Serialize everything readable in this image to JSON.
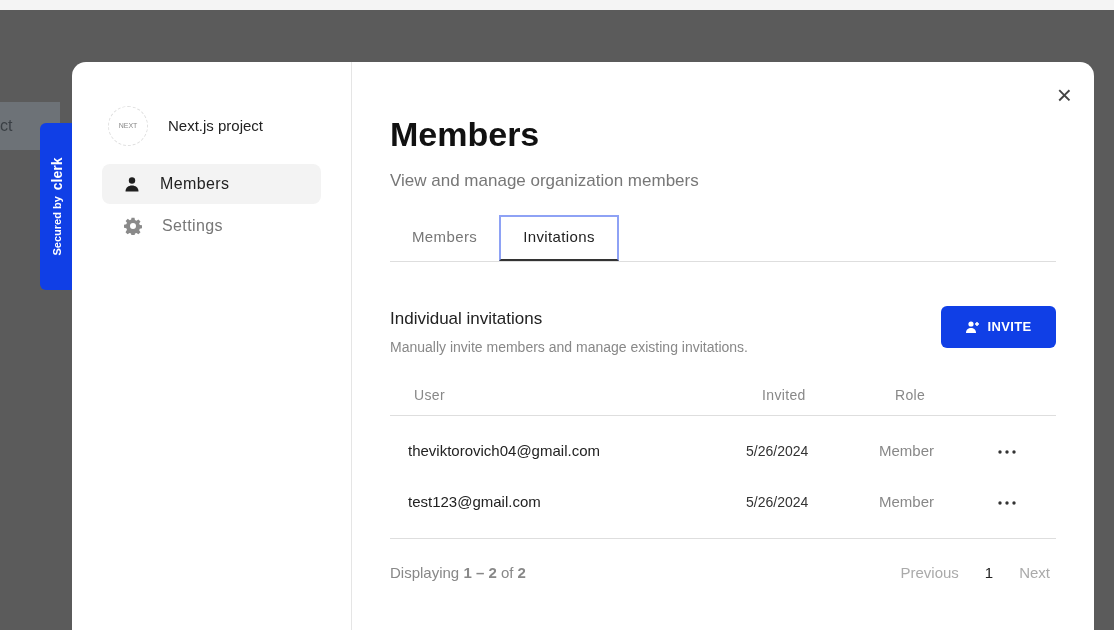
{
  "background": {
    "text": "ct"
  },
  "badge": {
    "prefix": "Secured by",
    "brand": "clerk"
  },
  "sidebar": {
    "org": {
      "logo_text": "NEXT",
      "name": "Next.js project"
    },
    "items": [
      {
        "label": "Members",
        "kind": "person",
        "selected": true
      },
      {
        "label": "Settings",
        "kind": "gear",
        "selected": false
      }
    ]
  },
  "close": "×",
  "header": {
    "title": "Members",
    "subtitle": "View and manage organization members"
  },
  "tabs": [
    {
      "label": "Members",
      "selected": false
    },
    {
      "label": "Invitations",
      "selected": true
    }
  ],
  "section": {
    "title": "Individual invitations",
    "description": "Manually invite members and manage existing invitations.",
    "button": "INVITE"
  },
  "table": {
    "columns": [
      "User",
      "Invited",
      "Role"
    ],
    "rows": [
      {
        "user": "theviktorovich04@gmail.com",
        "invited": "5/26/2024",
        "role": "Member"
      },
      {
        "user": "test123@gmail.com",
        "invited": "5/26/2024",
        "role": "Member"
      }
    ]
  },
  "footer": {
    "summary": "Displaying **1 – 2** of **2**",
    "pagination": [
      {
        "label": "Previous",
        "kind": "nav",
        "disabled": true
      },
      {
        "label": "1",
        "kind": "page",
        "selected": true
      },
      {
        "label": "Next",
        "kind": "nav",
        "disabled": true
      }
    ]
  }
}
